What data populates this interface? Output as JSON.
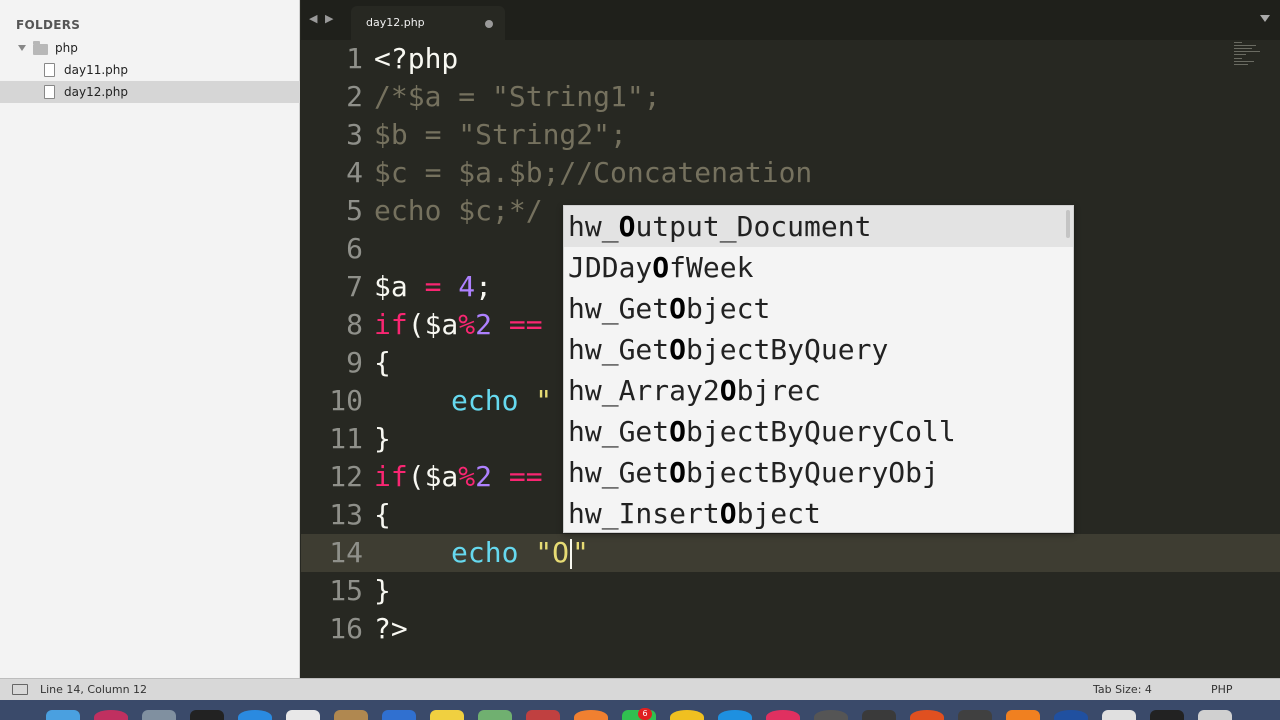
{
  "sidebar": {
    "title": "FOLDERS",
    "folder": "php",
    "files": [
      "day11.php",
      "day12.php"
    ]
  },
  "tabbar": {
    "nav_arrows": "◀ ▶",
    "active_tab": "day12.php"
  },
  "editor": {
    "line_numbers": [
      "1",
      "2",
      "3",
      "4",
      "5",
      "6",
      "7",
      "8",
      "9",
      "10",
      "11",
      "12",
      "13",
      "14",
      "15",
      "16"
    ],
    "lines": {
      "l1": "<?php",
      "l2": "/*$a = \"String1\";",
      "l3": "$b = \"String2\";",
      "l4": "$c = $a.$b;//Concatenation",
      "l5": "echo $c;*/",
      "l7_var": "$a",
      "l7_eq": " = ",
      "l7_num": "4",
      "l7_end": ";",
      "l8_if": "if",
      "l8_open": "($a",
      "l8_mod": "%",
      "l8_num": "2",
      "l8_sp": " ",
      "l8_eq": "==",
      "brace_open": "{",
      "brace_close": "}",
      "echo": "echo",
      "l10_q": "\"",
      "l14_q1": "\"",
      "l14_typed": "O",
      "l14_q2": "\"",
      "l16": "?>"
    }
  },
  "autocomplete": {
    "items": [
      {
        "pre": "hw_",
        "match": "O",
        "post": "utput_Document"
      },
      {
        "pre": "JDDay",
        "match": "O",
        "post": "fWeek"
      },
      {
        "pre": "hw_Get",
        "match": "O",
        "post": "bject"
      },
      {
        "pre": "hw_Get",
        "match": "O",
        "post": "bjectByQuery"
      },
      {
        "pre": "hw_Array2",
        "match": "O",
        "post": "bjrec"
      },
      {
        "pre": "hw_Get",
        "match": "O",
        "post": "bjectByQueryColl"
      },
      {
        "pre": "hw_Get",
        "match": "O",
        "post": "bjectByQueryObj"
      },
      {
        "pre": "hw_Insert",
        "match": "O",
        "post": "bject"
      }
    ]
  },
  "statusbar": {
    "position": "Line 14, Column 12",
    "tab_size": "Tab Size: 4",
    "syntax": "PHP"
  },
  "dock": {
    "badge": "6"
  },
  "colors": {
    "editor_bg": "#272822",
    "keyword": "#f92672",
    "number": "#ae81ff",
    "function": "#66d9ef",
    "string": "#e6db74",
    "comment": "#75715e"
  }
}
